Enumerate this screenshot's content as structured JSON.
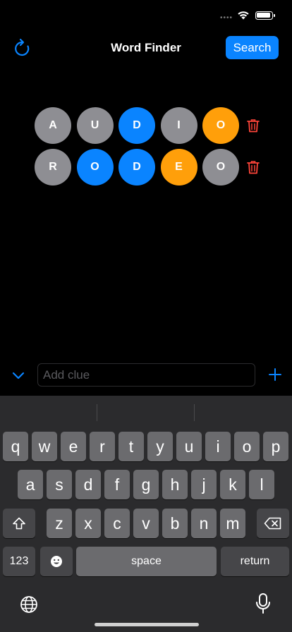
{
  "status_bar": {
    "dots": "••••"
  },
  "nav": {
    "title": "Word Finder",
    "search_label": "Search",
    "refresh_icon": "refresh-icon"
  },
  "guesses": [
    {
      "tiles": [
        {
          "letter": "A",
          "state": "gray"
        },
        {
          "letter": "U",
          "state": "gray"
        },
        {
          "letter": "D",
          "state": "blue"
        },
        {
          "letter": "I",
          "state": "gray"
        },
        {
          "letter": "O",
          "state": "orange"
        }
      ]
    },
    {
      "tiles": [
        {
          "letter": "R",
          "state": "gray"
        },
        {
          "letter": "O",
          "state": "blue"
        },
        {
          "letter": "D",
          "state": "blue"
        },
        {
          "letter": "E",
          "state": "orange"
        },
        {
          "letter": "O",
          "state": "gray"
        }
      ]
    }
  ],
  "colors": {
    "gray": "#8e8e93",
    "blue": "#0a84ff",
    "orange": "#ff9f0a",
    "trash": "#ff453a"
  },
  "clue": {
    "placeholder": "Add clue",
    "value": ""
  },
  "keyboard": {
    "row1": [
      "q",
      "w",
      "e",
      "r",
      "t",
      "y",
      "u",
      "i",
      "o",
      "p"
    ],
    "row2": [
      "a",
      "s",
      "d",
      "f",
      "g",
      "h",
      "j",
      "k",
      "l"
    ],
    "row3": [
      "z",
      "x",
      "c",
      "v",
      "b",
      "n",
      "m"
    ],
    "numbers_label": "123",
    "space_label": "space",
    "return_label": "return"
  }
}
